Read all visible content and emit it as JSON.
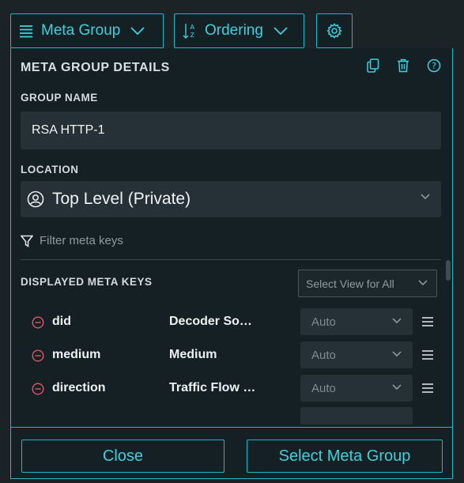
{
  "toolbar": {
    "meta_group_label": "Meta Group",
    "ordering_label": "Ordering"
  },
  "panel": {
    "title": "META GROUP DETAILS",
    "group_name_label": "GROUP NAME",
    "group_name_value": "RSA HTTP-1",
    "location_label": "LOCATION",
    "location_value": "Top Level (Private)",
    "filter_placeholder": "Filter meta keys",
    "displayed_meta_keys_label": "DISPLAYED META KEYS",
    "select_view_all": "Select View for All",
    "rows": [
      {
        "key": "did",
        "display": "Decoder So…",
        "view": "Auto"
      },
      {
        "key": "medium",
        "display": "Medium",
        "view": "Auto"
      },
      {
        "key": "direction",
        "display": "Traffic Flow …",
        "view": "Auto"
      }
    ]
  },
  "footer": {
    "close_label": "Close",
    "select_label": "Select Meta Group"
  },
  "colors": {
    "accent": "#1fb7c7",
    "accent_text": "#3fd0dd",
    "panel_bg": "#142024",
    "field_bg": "#253136",
    "remove_icon": "#e0566a"
  },
  "icons": [
    "list-icon",
    "chevron-down-icon",
    "sort-az-icon",
    "gear-icon",
    "copy-icon",
    "trash-icon",
    "help-icon",
    "user-circle-icon",
    "filter-icon",
    "minus-circle-icon",
    "drag-handle-icon"
  ]
}
